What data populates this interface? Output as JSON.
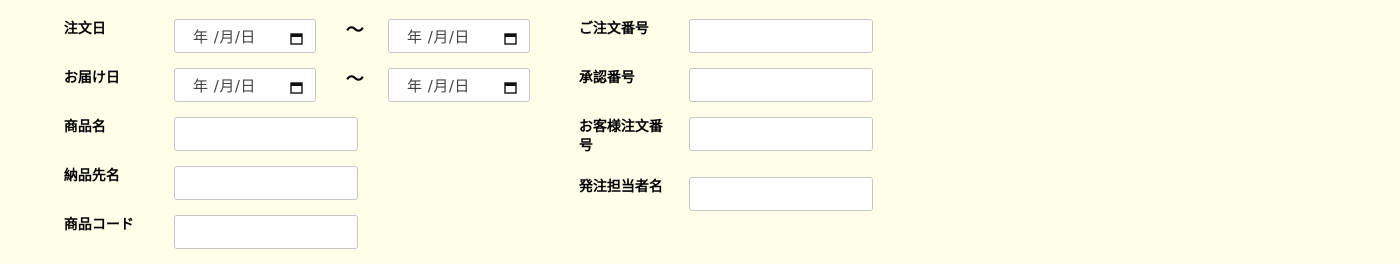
{
  "left": {
    "order_date": {
      "label": "注文日",
      "from_placeholder": "年 /月/日",
      "separator": "〜",
      "to_placeholder": "年 /月/日"
    },
    "delivery_date": {
      "label": "お届け日",
      "from_placeholder": "年 /月/日",
      "separator": "〜",
      "to_placeholder": "年 /月/日"
    },
    "product_name": {
      "label": "商品名",
      "value": ""
    },
    "delivery_destination": {
      "label": "納品先名",
      "value": ""
    },
    "product_code": {
      "label": "商品コード",
      "value": ""
    }
  },
  "right": {
    "order_number": {
      "label": "ご注文番号",
      "value": ""
    },
    "approval_number": {
      "label": "承認番号",
      "value": ""
    },
    "customer_order_number": {
      "label_line1": "お客様注文番",
      "label_line2": "号",
      "value": ""
    },
    "order_staff_name": {
      "label": "発注担当者名",
      "value": ""
    }
  },
  "icons": {
    "date_picker": "calendar-icon"
  },
  "colors": {
    "background": "#fefee9",
    "input_border": "#c6c6c6"
  }
}
